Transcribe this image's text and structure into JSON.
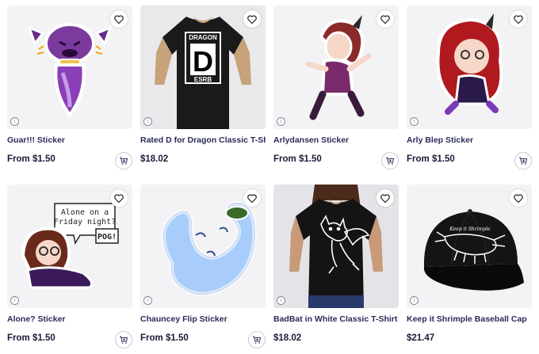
{
  "products": [
    {
      "title": "Guar!!! Sticker",
      "price_prefix": "From ",
      "price": "$1.50"
    },
    {
      "title": "Rated D for Dragon Classic T-Shirt",
      "price_prefix": "",
      "price": "$18.02"
    },
    {
      "title": "Arlydansen Sticker",
      "price_prefix": "From ",
      "price": "$1.50"
    },
    {
      "title": "Arly Blep Sticker",
      "price_prefix": "From ",
      "price": "$1.50"
    },
    {
      "title": "Alone? Sticker",
      "price_prefix": "From ",
      "price": "$1.50"
    },
    {
      "title": "Chauncey Flip Sticker",
      "price_prefix": "From ",
      "price": "$1.50"
    },
    {
      "title": "BadBat in White Classic T-Shirt",
      "price_prefix": "",
      "price": "$18.02"
    },
    {
      "title": "Keep it Shrimple Baseball Cap",
      "price_prefix": "",
      "price": "$21.47"
    }
  ],
  "artwork": {
    "dragon_tee_top": "DRAGON",
    "dragon_tee_letter": "D",
    "dragon_tee_bottom": "ESRB",
    "alone_bubble_line1": "Alone on a",
    "alone_bubble_line2": "Friday night?",
    "alone_bubble_pog": "POG!",
    "cap_text": "Keep it Shrimple"
  },
  "icons": {
    "wishlist": "heart-icon",
    "cart": "add-to-cart-icon",
    "info": "info-icon"
  },
  "colors": {
    "text": "#2b2b5a",
    "tile_bg": "#f3f3f5"
  }
}
